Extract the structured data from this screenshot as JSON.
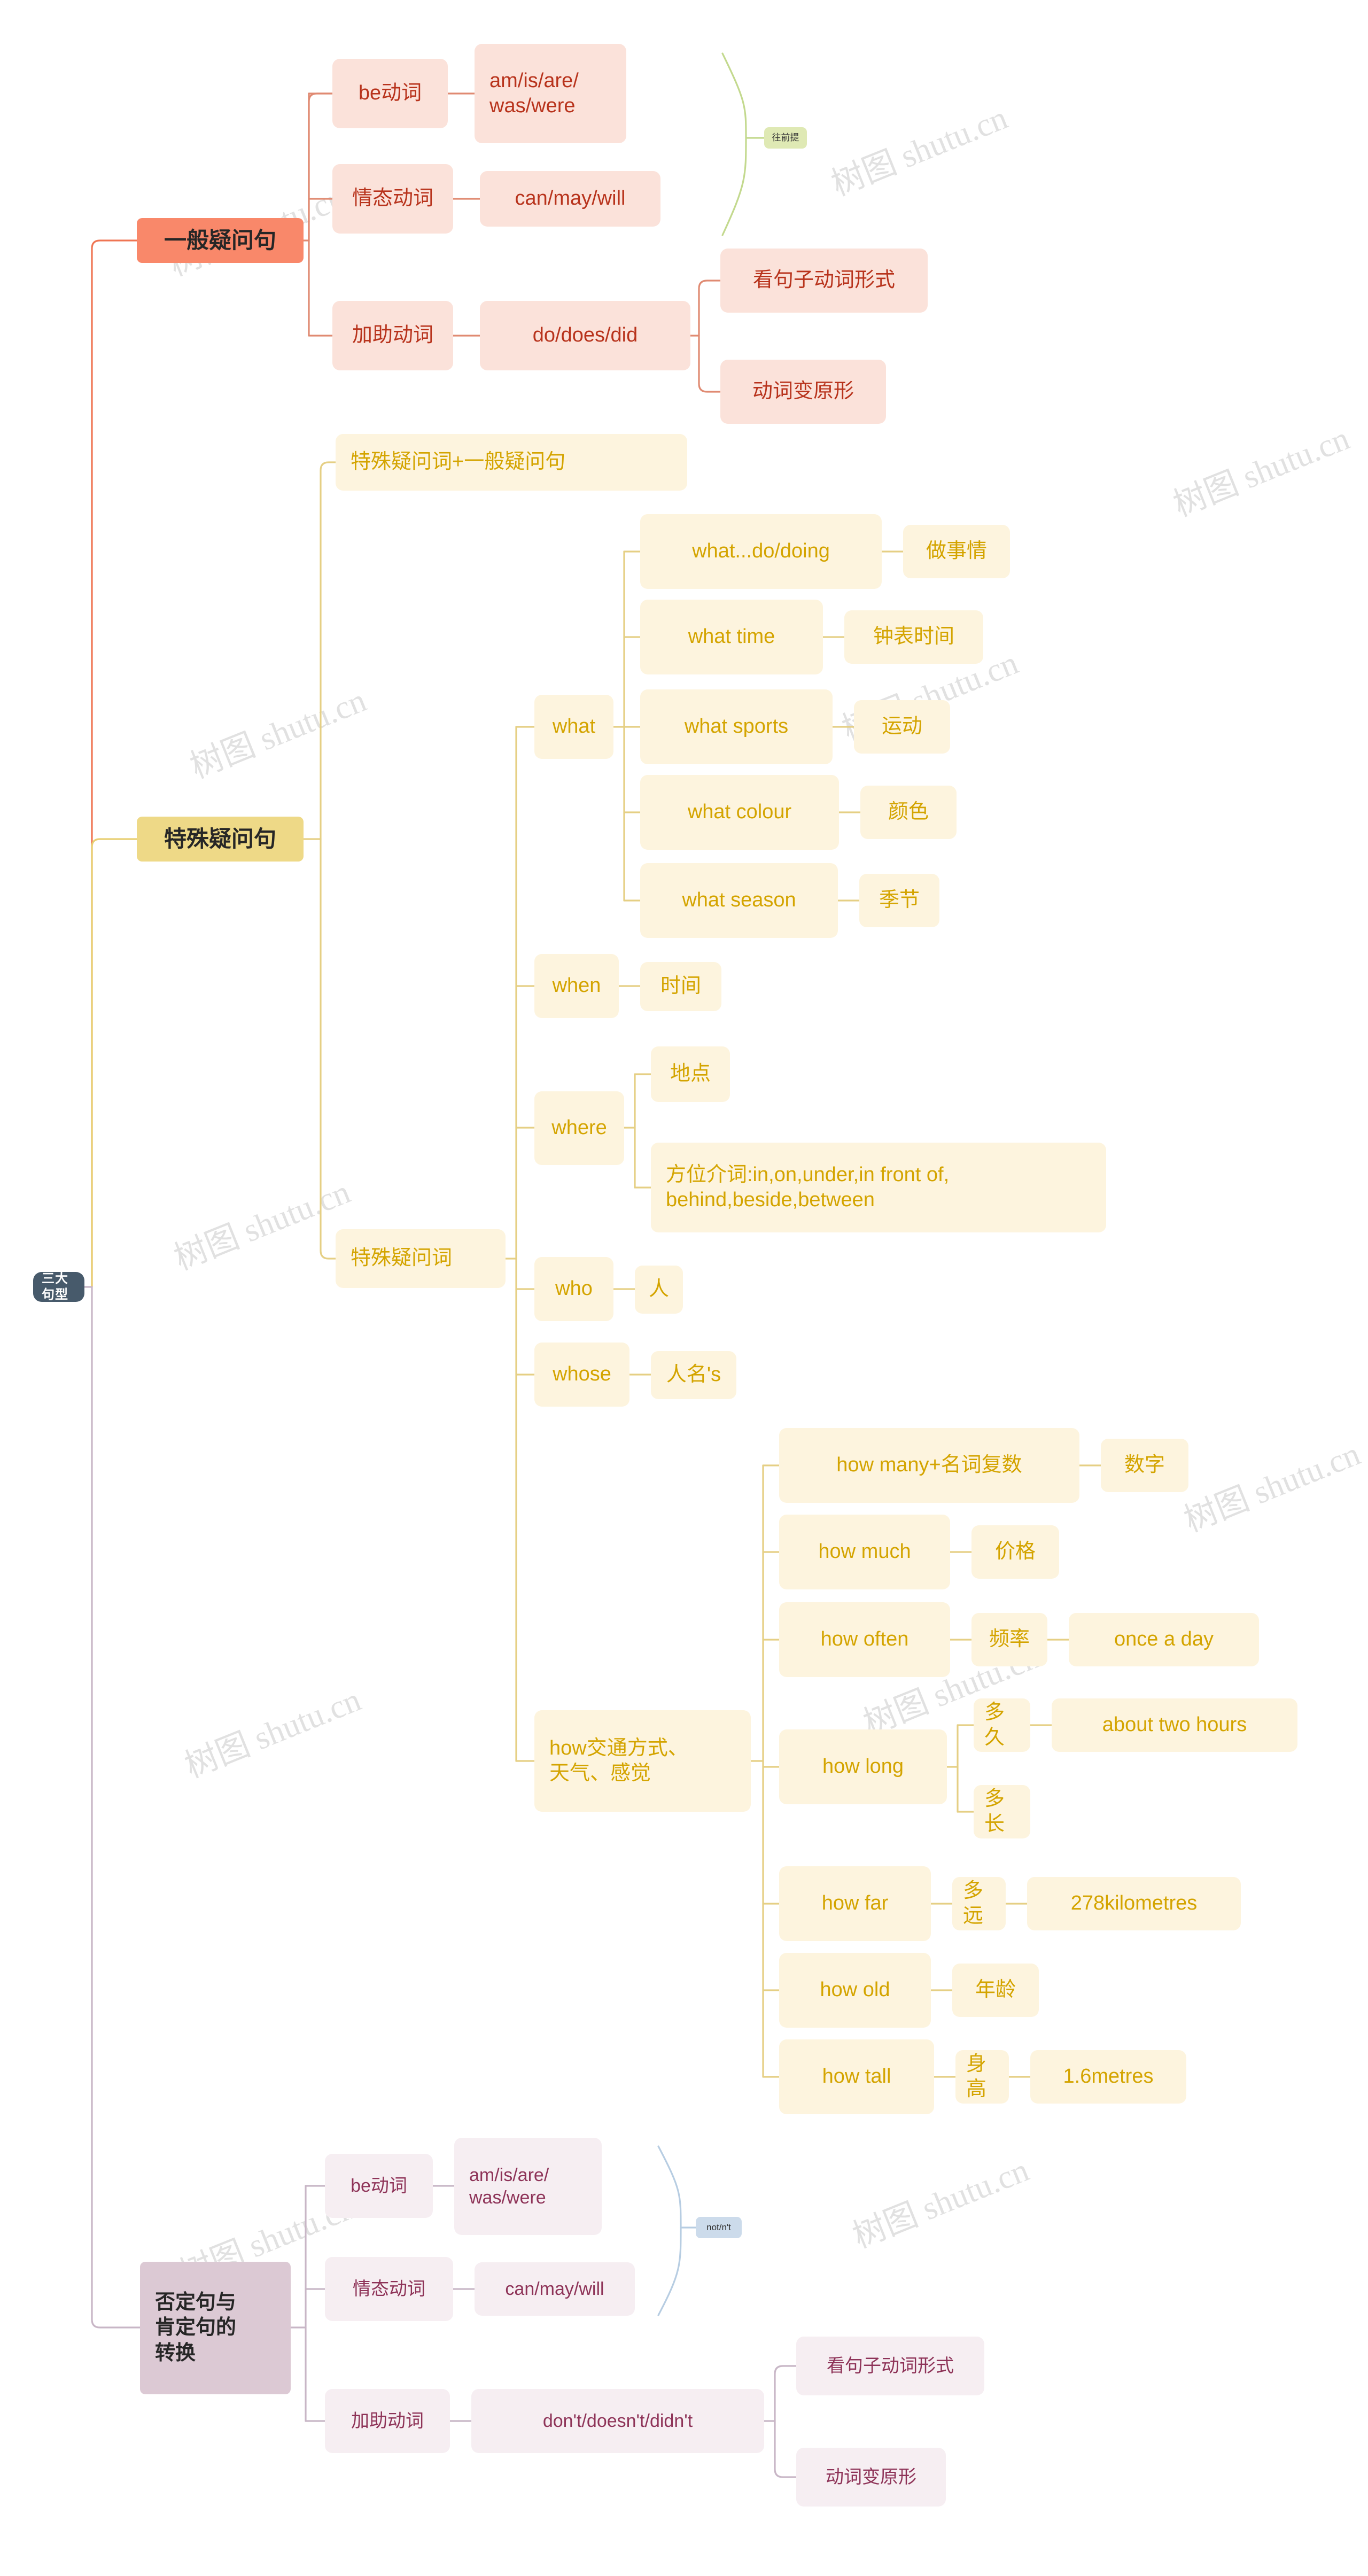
{
  "diagram": {
    "type": "mind-map",
    "title": "三大句型",
    "watermark_text": "树图 shutu.cn",
    "colors": {
      "root_bg": "#475a6b",
      "root_text": "#ffffff",
      "branch_red": "#f9886a",
      "branch_yellow": "#eed987",
      "branch_purple": "#dcc9d4",
      "sub_red_bg": "#fbe2da",
      "sub_red_text": "#b8331c",
      "sub_yellow_bg": "#fdf4de",
      "sub_yellow_text": "#d4a400",
      "sub_purple_bg": "#f6eef2",
      "sub_purple_text": "#8e3358",
      "tag_green_bg": "#dfe9b4",
      "tag_blue_bg": "#ccdbeb"
    },
    "root": {
      "label": "三大句型"
    },
    "branches": [
      {
        "id": "yiban",
        "label": "一般疑问句",
        "color": "red",
        "children": [
          {
            "label": "be动词",
            "children": [
              {
                "label": "am/is/are/\nwas/were"
              }
            ]
          },
          {
            "label": "情态动词",
            "children": [
              {
                "label": "can/may/will"
              }
            ]
          },
          {
            "label": "加助动词",
            "children": [
              {
                "label": "do/does/did",
                "children": [
                  {
                    "label": "看句子动词形式"
                  },
                  {
                    "label": "动词变原形"
                  }
                ]
              }
            ]
          }
        ],
        "annotation": {
          "label": "往前提",
          "color": "green"
        }
      },
      {
        "id": "teshu",
        "label": "特殊疑问句",
        "color": "yellow",
        "children": [
          {
            "label": "特殊疑问词+一般疑问句"
          },
          {
            "label": "特殊疑问词",
            "children": [
              {
                "label": "what",
                "children": [
                  {
                    "label": "what...do/doing",
                    "children": [
                      {
                        "label": "做事情"
                      }
                    ]
                  },
                  {
                    "label": "what time",
                    "children": [
                      {
                        "label": "钟表时间"
                      }
                    ]
                  },
                  {
                    "label": "what sports",
                    "children": [
                      {
                        "label": "运动"
                      }
                    ]
                  },
                  {
                    "label": "what colour",
                    "children": [
                      {
                        "label": "颜色"
                      }
                    ]
                  },
                  {
                    "label": "what season",
                    "children": [
                      {
                        "label": "季节"
                      }
                    ]
                  }
                ]
              },
              {
                "label": "when",
                "children": [
                  {
                    "label": "时间"
                  }
                ]
              },
              {
                "label": "where",
                "children": [
                  {
                    "label": "地点"
                  },
                  {
                    "label": "方位介词:in,on,under,in front of,\nbehind,beside,between"
                  }
                ]
              },
              {
                "label": "who",
                "children": [
                  {
                    "label": "人"
                  }
                ]
              },
              {
                "label": "whose",
                "children": [
                  {
                    "label": "人名's"
                  }
                ]
              },
              {
                "label": "how交通方式、\n天气、感觉",
                "children": [
                  {
                    "label": "how many+名词复数",
                    "children": [
                      {
                        "label": "数字"
                      }
                    ]
                  },
                  {
                    "label": "how much",
                    "children": [
                      {
                        "label": "价格"
                      }
                    ]
                  },
                  {
                    "label": "how often",
                    "children": [
                      {
                        "label": "频率",
                        "children": [
                          {
                            "label": "once a day"
                          }
                        ]
                      }
                    ]
                  },
                  {
                    "label": "how long",
                    "children": [
                      {
                        "label": "多久",
                        "children": [
                          {
                            "label": "about two hours"
                          }
                        ]
                      },
                      {
                        "label": "多长"
                      }
                    ]
                  },
                  {
                    "label": "how far",
                    "children": [
                      {
                        "label": "多远",
                        "children": [
                          {
                            "label": "278kilometres"
                          }
                        ]
                      }
                    ]
                  },
                  {
                    "label": "how old",
                    "children": [
                      {
                        "label": "年龄"
                      }
                    ]
                  },
                  {
                    "label": "how tall",
                    "children": [
                      {
                        "label": "身高",
                        "children": [
                          {
                            "label": "1.6metres"
                          }
                        ]
                      }
                    ]
                  }
                ]
              }
            ]
          }
        ]
      },
      {
        "id": "fouding",
        "label": "否定句与\n肯定句的\n转换",
        "color": "purple",
        "children": [
          {
            "label": "be动词",
            "children": [
              {
                "label": "am/is/are/\nwas/were"
              }
            ]
          },
          {
            "label": "情态动词",
            "children": [
              {
                "label": "can/may/will"
              }
            ]
          },
          {
            "label": "加助动词",
            "children": [
              {
                "label": "don't/doesn't/didn't",
                "children": [
                  {
                    "label": "看句子动词形式"
                  },
                  {
                    "label": "动词变原形"
                  }
                ]
              }
            ]
          }
        ],
        "annotation": {
          "label": "not/n't",
          "color": "blue"
        }
      }
    ]
  },
  "nodes": {
    "root": "三大句型",
    "r1_title": "一般疑问句",
    "r1_be": "be动词",
    "r1_be_v": "am/is/are/\nwas/were",
    "r1_modal": "情态动词",
    "r1_modal_v": "can/may/will",
    "r1_aux": "加助动词",
    "r1_aux_v": "do/does/did",
    "r1_aux_c1": "看句子动词形式",
    "r1_aux_c2": "动词变原形",
    "r1_tag": "往前提",
    "y_title": "特殊疑问句",
    "y_formula": "特殊疑问词+一般疑问句",
    "y_words": "特殊疑问词",
    "y_what": "what",
    "y_what_1": "what...do/doing",
    "y_what_1v": "做事情",
    "y_what_2": "what time",
    "y_what_2v": "钟表时间",
    "y_what_3": "what sports",
    "y_what_3v": "运动",
    "y_what_4": "what colour",
    "y_what_4v": "颜色",
    "y_what_5": "what season",
    "y_what_5v": "季节",
    "y_when": "when",
    "y_when_v": "时间",
    "y_where": "where",
    "y_where_1": "地点",
    "y_where_2": "方位介词:in,on,under,in front of,\nbehind,beside,between",
    "y_who": "who",
    "y_who_v": "人",
    "y_whose": "whose",
    "y_whose_v": "人名's",
    "y_how": "how交通方式、\n天气、感觉",
    "y_how_many": "how many+名词复数",
    "y_how_many_v": "数字",
    "y_how_much": "how much",
    "y_how_much_v": "价格",
    "y_how_often": "how often",
    "y_how_often_v": "频率",
    "y_how_often_v2": "once a day",
    "y_how_long": "how long",
    "y_how_long_1": "多久",
    "y_how_long_1v": "about two hours",
    "y_how_long_2": "多长",
    "y_how_far": "how far",
    "y_how_far_v": "多远",
    "y_how_far_v2": "278kilometres",
    "y_how_old": "how old",
    "y_how_old_v": "年龄",
    "y_how_tall": "how tall",
    "y_how_tall_v": "身高",
    "y_how_tall_v2": "1.6metres",
    "p_title": "否定句与\n肯定句的\n转换",
    "p_be": "be动词",
    "p_be_v": "am/is/are/\nwas/were",
    "p_modal": "情态动词",
    "p_modal_v": "can/may/will",
    "p_aux": "加助动词",
    "p_aux_v": "don't/doesn't/didn't",
    "p_aux_c1": "看句子动词形式",
    "p_aux_c2": "动词变原形",
    "p_tag": "not/n't"
  },
  "watermarks": [
    {
      "text": "树图 shutu.cn"
    },
    {
      "text": "树图 shutu.cn"
    },
    {
      "text": "树图 shutu.cn"
    },
    {
      "text": "树图 shutu.cn"
    },
    {
      "text": "树图 shutu.cn"
    },
    {
      "text": "树图 shutu.cn"
    },
    {
      "text": "树图 shutu.cn"
    },
    {
      "text": "树图 shutu.cn"
    },
    {
      "text": "树图 shutu.cn"
    },
    {
      "text": "树图 shutu.cn"
    },
    {
      "text": "树图 shutu.cn"
    },
    {
      "text": "树图 shutu.cn"
    }
  ]
}
